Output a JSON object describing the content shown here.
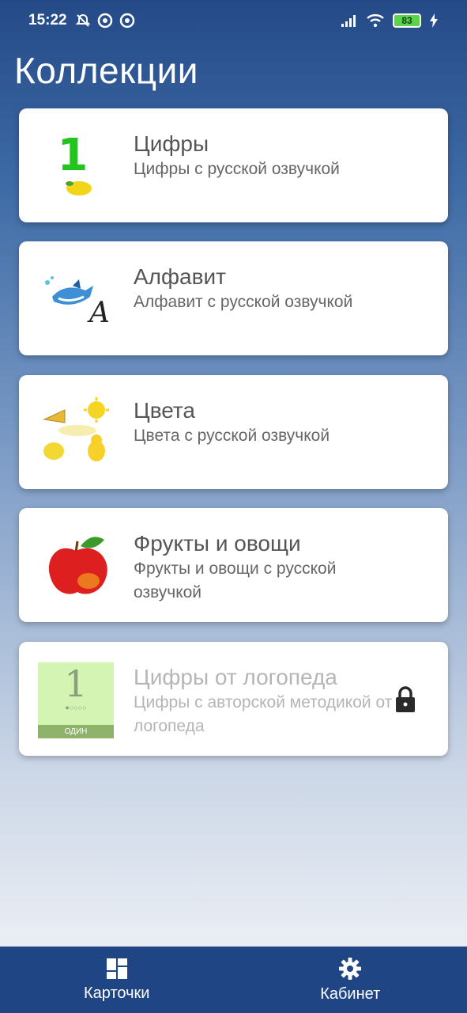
{
  "status_bar": {
    "time": "15:22",
    "battery": "83"
  },
  "page": {
    "title": "Коллекции"
  },
  "collections": [
    {
      "title": "Цифры",
      "description": "Цифры с русской озвучкой",
      "locked": false,
      "thumb": "digit-one-lemon-image"
    },
    {
      "title": "Алфавит",
      "description": "Алфавит с русской озвучкой",
      "locked": false,
      "thumb": "shark-letter-a-image"
    },
    {
      "title": "Цвета",
      "description": "Цвета с русской озвучкой",
      "locked": false,
      "thumb": "colors-collage-image"
    },
    {
      "title": "Фрукты и овощи",
      "description": "Фрукты и овощи с русской озвучкой",
      "locked": false,
      "thumb": "red-apple-image"
    },
    {
      "title": "Цифры от логопеда",
      "description": "Цифры с авторской методикой от логопеда",
      "locked": true,
      "thumb": "speech-therapist-digit-card",
      "thumb_digit": "1",
      "thumb_word": "ОДИН"
    }
  ],
  "bottom_nav": {
    "cards_label": "Карточки",
    "cabinet_label": "Кабинет"
  },
  "colors": {
    "nav_background": "#1f4584",
    "header_top": "#244a87"
  }
}
